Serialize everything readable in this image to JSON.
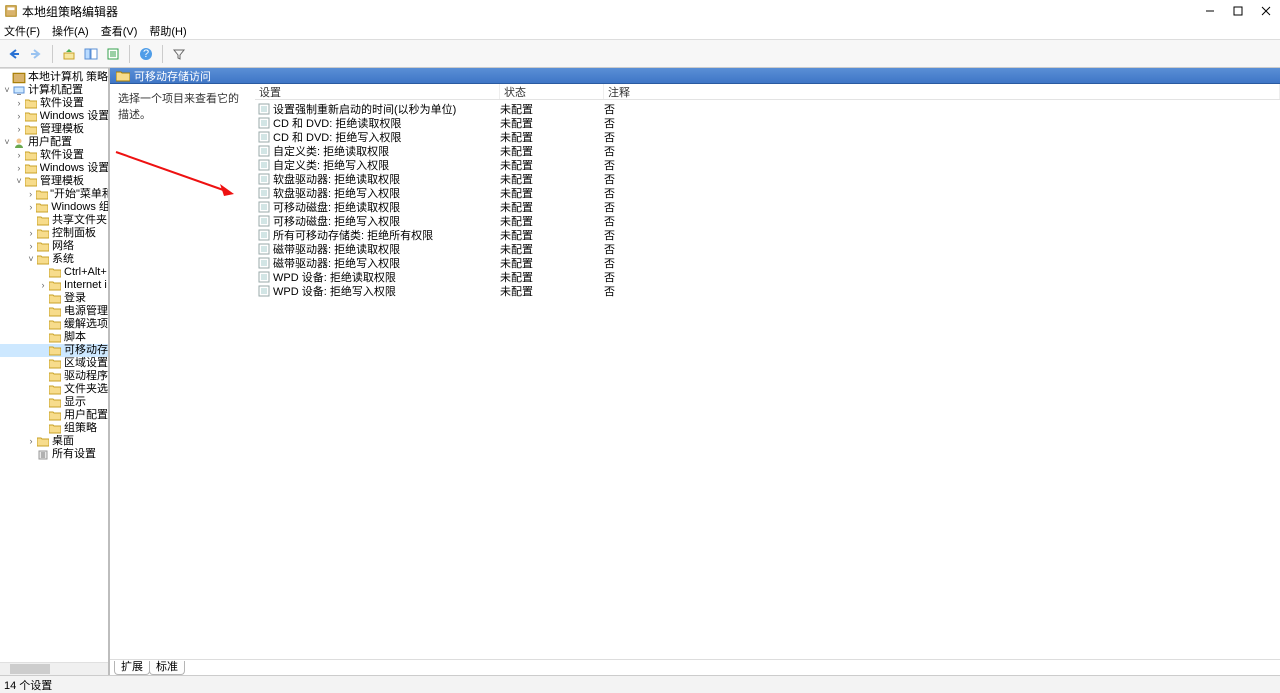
{
  "window": {
    "title": "本地组策略编辑器"
  },
  "menu": {
    "file": "文件(F)",
    "action": "操作(A)",
    "view": "查看(V)",
    "help": "帮助(H)"
  },
  "tree": {
    "root": "本地计算机 策略",
    "computer": "计算机配置",
    "comp_soft": "软件设置",
    "comp_win": "Windows 设置",
    "comp_admin": "管理模板",
    "user": "用户配置",
    "user_soft": "软件设置",
    "user_win": "Windows 设置",
    "user_admin": "管理模板",
    "start_menu": "\"开始\"菜单和",
    "win_group": "Windows 组",
    "shared": "共享文件夹",
    "control_panel": "控制面板",
    "network": "网络",
    "system": "系统",
    "ctrl_alt": "Ctrl+Alt+",
    "internet": "Internet i",
    "login": "登录",
    "power": "电源管理",
    "mitigation": "缓解选项",
    "scripts": "脚本",
    "removable": "可移动存",
    "locale": "区域设置",
    "driver": "驱动程序",
    "folder_ops": "文件夹选",
    "display": "显示",
    "user_profile": "用户配置",
    "group_policy": "组策略",
    "desktop": "桌面",
    "all_settings": "所有设置"
  },
  "main": {
    "header": "可移动存储访问",
    "desc_prompt": "选择一个项目来查看它的描述。",
    "col_setting": "设置",
    "col_state": "状态",
    "col_comment": "注释"
  },
  "rows": [
    {
      "name": "设置强制重新启动的时间(以秒为单位)",
      "state": "未配置",
      "comment": "否"
    },
    {
      "name": "CD 和 DVD: 拒绝读取权限",
      "state": "未配置",
      "comment": "否"
    },
    {
      "name": "CD 和 DVD: 拒绝写入权限",
      "state": "未配置",
      "comment": "否"
    },
    {
      "name": "自定义类: 拒绝读取权限",
      "state": "未配置",
      "comment": "否"
    },
    {
      "name": "自定义类: 拒绝写入权限",
      "state": "未配置",
      "comment": "否"
    },
    {
      "name": "软盘驱动器: 拒绝读取权限",
      "state": "未配置",
      "comment": "否"
    },
    {
      "name": "软盘驱动器: 拒绝写入权限",
      "state": "未配置",
      "comment": "否"
    },
    {
      "name": "可移动磁盘: 拒绝读取权限",
      "state": "未配置",
      "comment": "否"
    },
    {
      "name": "可移动磁盘: 拒绝写入权限",
      "state": "未配置",
      "comment": "否"
    },
    {
      "name": "所有可移动存储类: 拒绝所有权限",
      "state": "未配置",
      "comment": "否"
    },
    {
      "name": "磁带驱动器: 拒绝读取权限",
      "state": "未配置",
      "comment": "否"
    },
    {
      "name": "磁带驱动器: 拒绝写入权限",
      "state": "未配置",
      "comment": "否"
    },
    {
      "name": "WPD 设备: 拒绝读取权限",
      "state": "未配置",
      "comment": "否"
    },
    {
      "name": "WPD 设备: 拒绝写入权限",
      "state": "未配置",
      "comment": "否"
    }
  ],
  "tabs": {
    "extended": "扩展",
    "standard": "标准"
  },
  "status": {
    "count": "14 个设置"
  }
}
